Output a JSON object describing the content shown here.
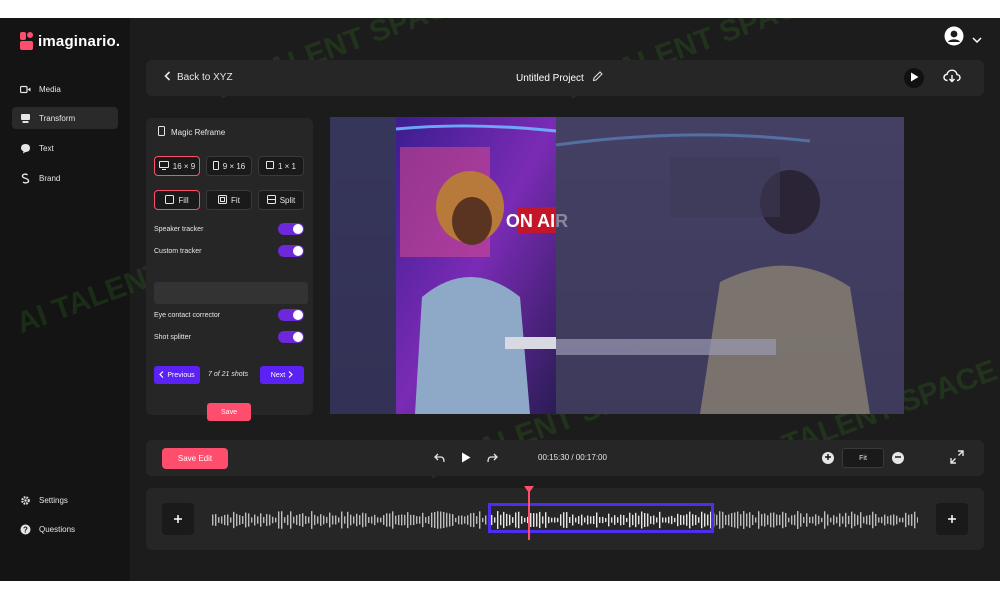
{
  "brand": {
    "name": "imaginario."
  },
  "sidebar": {
    "items": [
      {
        "label": "Media",
        "icon": "video-icon"
      },
      {
        "label": "Transform",
        "icon": "transform-icon",
        "active": true
      },
      {
        "label": "Text",
        "icon": "text-icon"
      },
      {
        "label": "Brand",
        "icon": "brand-icon"
      }
    ],
    "bottom": [
      {
        "label": "Settings",
        "icon": "gear-icon"
      },
      {
        "label": "Questions",
        "icon": "help-icon"
      }
    ]
  },
  "topbar": {
    "back_label": "Back to XYZ",
    "project_title": "Untitled Project"
  },
  "panel": {
    "title": "Magic Reframe",
    "aspect_options": [
      "16 × 9",
      "9 × 16",
      "1 × 1"
    ],
    "aspect_selected": "16 × 9",
    "mode_options": [
      "Fill",
      "Fit",
      "Split"
    ],
    "mode_selected": "Fill",
    "toggles": [
      {
        "label": "Speaker tracker",
        "on": true
      },
      {
        "label": "Custom tracker",
        "on": true
      },
      {
        "label": "Eye contact corrector",
        "on": true
      },
      {
        "label": "Shot splitter",
        "on": true
      }
    ],
    "custom_tracker_value": "",
    "previous_label": "Previous",
    "shots_label": "7 of 21 shots",
    "next_label": "Next",
    "save_label": "Save"
  },
  "preview": {
    "sign_text": "ON AIR"
  },
  "controls": {
    "save_edit_label": "Save Edit",
    "time": "00:15:30 / 00:17:00",
    "fit_label": "Fit"
  },
  "watermark": {
    "text": "AI TALENT SPACE"
  },
  "colors": {
    "accent": "#ff4d6d",
    "purple": "#5b21f5",
    "toggle": "#6d28d9",
    "bg": "#1c1c1c",
    "panel": "#262626"
  }
}
